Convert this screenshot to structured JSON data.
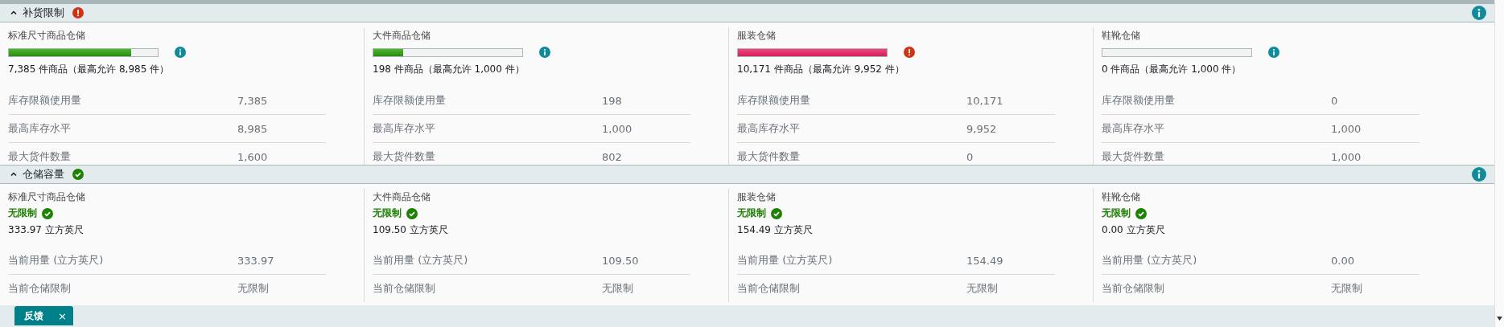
{
  "sections": [
    {
      "title": "补货限制",
      "error": true,
      "expanded": true,
      "columns": [
        {
          "kind": "meter",
          "title": "标准尺寸商品仓储",
          "error": false,
          "level": 0.82,
          "summary": "7,385 件商品（最高允许 8,985 件）",
          "rows": [
            {
              "label": "库存限额使用量",
              "value": "7,385"
            },
            {
              "label": "最高库存水平",
              "value": "8,985"
            },
            {
              "label": "最大货件数量",
              "value": "1,600"
            }
          ]
        },
        {
          "kind": "meter",
          "title": "大件商品仓储",
          "error": false,
          "level": 0.198,
          "summary": "198 件商品（最高允许 1,000 件）",
          "rows": [
            {
              "label": "库存限额使用量",
              "value": "198"
            },
            {
              "label": "最高库存水平",
              "value": "1,000"
            },
            {
              "label": "最大货件数量",
              "value": "802"
            }
          ]
        },
        {
          "kind": "meter",
          "title": "服装仓储",
          "error": true,
          "level": 1,
          "summary": "10,171 件商品（最高允许 9,952 件）",
          "rows": [
            {
              "label": "库存限额使用量",
              "value": "10,171"
            },
            {
              "label": "最高库存水平",
              "value": "9,952"
            },
            {
              "label": "最大货件数量",
              "value": "0"
            }
          ]
        },
        {
          "kind": "meter",
          "title": "鞋靴仓储",
          "error": false,
          "level": 0,
          "summary": "0 件商品（最高允许 1,000 件）",
          "rows": [
            {
              "label": "库存限额使用量",
              "value": "0"
            },
            {
              "label": "最高库存水平",
              "value": "1,000"
            },
            {
              "label": "最大货件数量",
              "value": "1,000"
            }
          ]
        }
      ]
    },
    {
      "title": "仓储容量",
      "error": false,
      "expanded": true,
      "columns": [
        {
          "kind": "status",
          "title": "标准尺寸商品仓储",
          "error": false,
          "badge": "无限制",
          "summary": "333.97 立方英尺",
          "rows": [
            {
              "label": "当前用量 (立方英尺)",
              "value": "333.97"
            },
            {
              "label": "当前仓储限制",
              "value": "无限制"
            }
          ]
        },
        {
          "kind": "status",
          "title": "大件商品仓储",
          "error": false,
          "badge": "无限制",
          "summary": "109.50 立方英尺",
          "rows": [
            {
              "label": "当前用量 (立方英尺)",
              "value": "109.50"
            },
            {
              "label": "当前仓储限制",
              "value": "无限制"
            }
          ]
        },
        {
          "kind": "status",
          "title": "服装仓储",
          "error": false,
          "badge": "无限制",
          "summary": "154.49 立方英尺",
          "rows": [
            {
              "label": "当前用量 (立方英尺)",
              "value": "154.49"
            },
            {
              "label": "当前仓储限制",
              "value": "无限制"
            }
          ]
        },
        {
          "kind": "status",
          "title": "鞋靴仓储",
          "error": false,
          "badge": "无限制",
          "summary": "0.00 立方英尺",
          "rows": [
            {
              "label": "当前用量 (立方英尺)",
              "value": "0.00"
            },
            {
              "label": "当前仓储限制",
              "value": "无限制"
            }
          ]
        }
      ]
    }
  ],
  "feedback": {
    "label": "反馈",
    "close": "×"
  }
}
